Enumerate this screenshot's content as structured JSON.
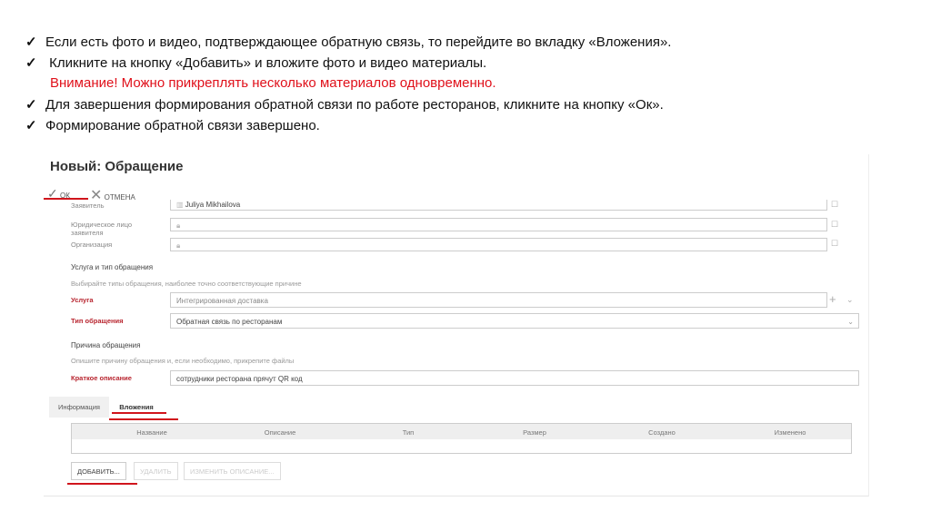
{
  "instructions": [
    "Если есть фото и видео, подтверждающее обратную связь, то перейдите во вкладку «Вложения».",
    " Кликните на кнопку «Добавить» и вложите фото и видео материалы.",
    "Для завершения формирования обратной связи по работе ресторанов, кликните на кнопку «Ок».",
    "Формирование обратной связи завершено."
  ],
  "warning": "Внимание! Можно прикреплять несколько материалов одновременно.",
  "check_glyph": "✓",
  "accent": "#d0141c",
  "form": {
    "title": "Новый: Обращение",
    "toolbar": {
      "ok": "ОК",
      "cancel": "ОТМЕНА"
    },
    "applicant_label": "Заявитель",
    "applicant_value": "Juliya Mikhailova",
    "legal_label": "Юридическое лицо заявителя",
    "org_label": "Организация",
    "section1": "Услуга и тип обращения",
    "hint1": "Выбирайте типы обращения, наиболее точно соответствующие причине",
    "service_label": "Услуга",
    "service_value": "Интегрированная доставка",
    "type_label": "Тип обращения",
    "type_value": "Обратная связь по ресторанам",
    "section2": "Причина обращения",
    "hint2": "Опишите причину обращения и, если необходимо, прикрепите файлы",
    "desc_label": "Краткое описание",
    "desc_value": "сотрудники ресторана прячут  QR код",
    "tabs": [
      "Информация",
      "Вложения"
    ],
    "active_tab": "Вложения",
    "columns": [
      "Название",
      "Описание",
      "Тип",
      "Размер",
      "Создано",
      "Изменено"
    ],
    "buttons": {
      "add": "ДОБАВИТЬ...",
      "delete": "УДАЛИТЬ",
      "edit": "ИЗМЕНИТЬ ОПИСАНИЕ..."
    }
  }
}
